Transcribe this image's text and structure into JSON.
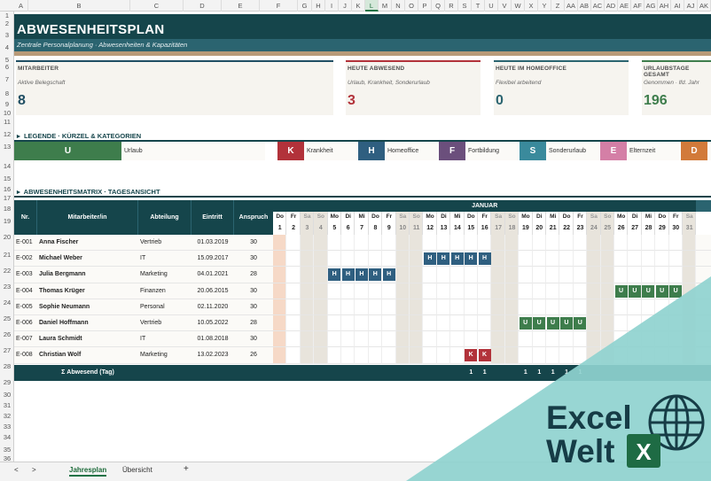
{
  "columns": [
    "A",
    "B",
    "C",
    "D",
    "E",
    "F",
    "G",
    "H",
    "I",
    "J",
    "K",
    "L",
    "M",
    "N",
    "O",
    "P",
    "Q",
    "R",
    "S",
    "T",
    "U",
    "V",
    "W",
    "X",
    "Y",
    "Z",
    "AA",
    "AB",
    "AC",
    "AD",
    "AE",
    "AF",
    "AG",
    "AH",
    "AI",
    "AJ",
    "AK"
  ],
  "selected_column": "L",
  "rows": [
    "1",
    "2",
    "3",
    "4",
    "5",
    "6",
    "7",
    "8",
    "9",
    "10",
    "11",
    "12",
    "13",
    "14",
    "15",
    "16",
    "17",
    "18",
    "19",
    "20",
    "21",
    "22",
    "23",
    "24",
    "25",
    "26",
    "27",
    "28",
    "29",
    "30",
    "31",
    "32",
    "33",
    "34",
    "35",
    "36"
  ],
  "title": "ABWESENHEITSPLAN",
  "subtitle": "Zentrale Personalplanung · Abwesenheiten & Kapazitäten",
  "kpis": [
    {
      "label": "MITARBEITER",
      "sub": "Aktive Belegschaft",
      "value": "8",
      "color": "#1f4e63"
    },
    {
      "label": "HEUTE ABWESEND",
      "sub": "Urlaub, Krankheit, Sonderurlaub",
      "value": "3",
      "color": "#b2323a"
    },
    {
      "label": "HEUTE IM HOMEOFFICE",
      "sub": "Flexibel arbeitend",
      "value": "0",
      "color": "#2b6470"
    },
    {
      "label": "URLAUBSTAGE GESAMT",
      "sub": "Genommen · lfd. Jahr",
      "value": "196",
      "color": "#3e7d4c"
    }
  ],
  "legend_title": "LEGENDE · KÜRZEL & KATEGORIEN",
  "legend": [
    {
      "code": "U",
      "name": "Urlaub",
      "color": "#3e7d4c"
    },
    {
      "code": "K",
      "name": "Krankheit",
      "color": "#b2323a"
    },
    {
      "code": "H",
      "name": "Homeoffice",
      "color": "#2f5f80"
    },
    {
      "code": "F",
      "name": "Fortbildung",
      "color": "#6b4f7c"
    },
    {
      "code": "S",
      "name": "Sonderurlaub",
      "color": "#3a8a9c"
    },
    {
      "code": "E",
      "name": "Elternzeit",
      "color": "#d47fa6"
    },
    {
      "code": "D",
      "name": "",
      "color": "#d27a3a"
    }
  ],
  "matrix_title": "ABWESENHEITSMATRIX · TAGESANSICHT",
  "headers": {
    "nr": "Nr.",
    "name": "Mitarbeiter/in",
    "dept": "Abteilung",
    "entry": "Eintritt",
    "claim": "Anspruch",
    "month": "JANUAR"
  },
  "weekdays": [
    "Do",
    "Fr",
    "Sa",
    "So",
    "Mo",
    "Di",
    "Mi",
    "Do",
    "Fr",
    "Sa",
    "So",
    "Mo",
    "Di",
    "Mi",
    "Do",
    "Fr",
    "Sa",
    "So",
    "Mo",
    "Di",
    "Mi",
    "Do",
    "Fr",
    "Sa",
    "So",
    "Mo",
    "Di",
    "Mi",
    "Do",
    "Fr",
    "Sa"
  ],
  "days": [
    "1",
    "2",
    "3",
    "4",
    "5",
    "6",
    "7",
    "8",
    "9",
    "10",
    "11",
    "12",
    "13",
    "14",
    "15",
    "16",
    "17",
    "18",
    "19",
    "20",
    "21",
    "22",
    "23",
    "24",
    "25",
    "26",
    "27",
    "28",
    "29",
    "30",
    "31"
  ],
  "employees": [
    {
      "nr": "E-001",
      "name": "Anna Fischer",
      "dept": "Vertrieb",
      "entry": "01.03.2019",
      "claim": "30",
      "marks": {}
    },
    {
      "nr": "E-002",
      "name": "Michael Weber",
      "dept": "IT",
      "entry": "15.09.2017",
      "claim": "30",
      "marks": {
        "12": "H",
        "13": "H",
        "14": "H",
        "15": "H",
        "16": "H"
      }
    },
    {
      "nr": "E-003",
      "name": "Julia Bergmann",
      "dept": "Marketing",
      "entry": "04.01.2021",
      "claim": "28",
      "marks": {
        "5": "H",
        "6": "H",
        "7": "H",
        "8": "H",
        "9": "H"
      }
    },
    {
      "nr": "E-004",
      "name": "Thomas Krüger",
      "dept": "Finanzen",
      "entry": "20.06.2015",
      "claim": "30",
      "marks": {
        "26": "U",
        "27": "U",
        "28": "U",
        "29": "U",
        "30": "U"
      }
    },
    {
      "nr": "E-005",
      "name": "Sophie Neumann",
      "dept": "Personal",
      "entry": "02.11.2020",
      "claim": "30",
      "marks": {}
    },
    {
      "nr": "E-006",
      "name": "Daniel Hoffmann",
      "dept": "Vertrieb",
      "entry": "10.05.2022",
      "claim": "28",
      "marks": {
        "19": "U",
        "20": "U",
        "21": "U",
        "22": "U",
        "23": "U"
      }
    },
    {
      "nr": "E-007",
      "name": "Laura Schmidt",
      "dept": "IT",
      "entry": "01.08.2018",
      "claim": "30",
      "marks": {}
    },
    {
      "nr": "E-008",
      "name": "Christian Wolf",
      "dept": "Marketing",
      "entry": "13.02.2023",
      "claim": "26",
      "marks": {
        "15": "K",
        "16": "K"
      }
    }
  ],
  "sum_label": "Σ Abwesend (Tag)",
  "sums": {
    "15": "1",
    "16": "1",
    "19": "1",
    "20": "1",
    "21": "1",
    "22": "1",
    "23": "1"
  },
  "tabs": {
    "prev": "<",
    "next": ">",
    "sheet1": "Jahresplan",
    "sheet2": "Übersicht",
    "add": "+"
  },
  "watermark": {
    "line1": "Excel",
    "line2": "Welt",
    "badge": "X"
  },
  "colors": {
    "dark": "#15454b",
    "teal": "#2b6470",
    "weekend": "#e8e4dc",
    "today": "#f6d9c7"
  }
}
